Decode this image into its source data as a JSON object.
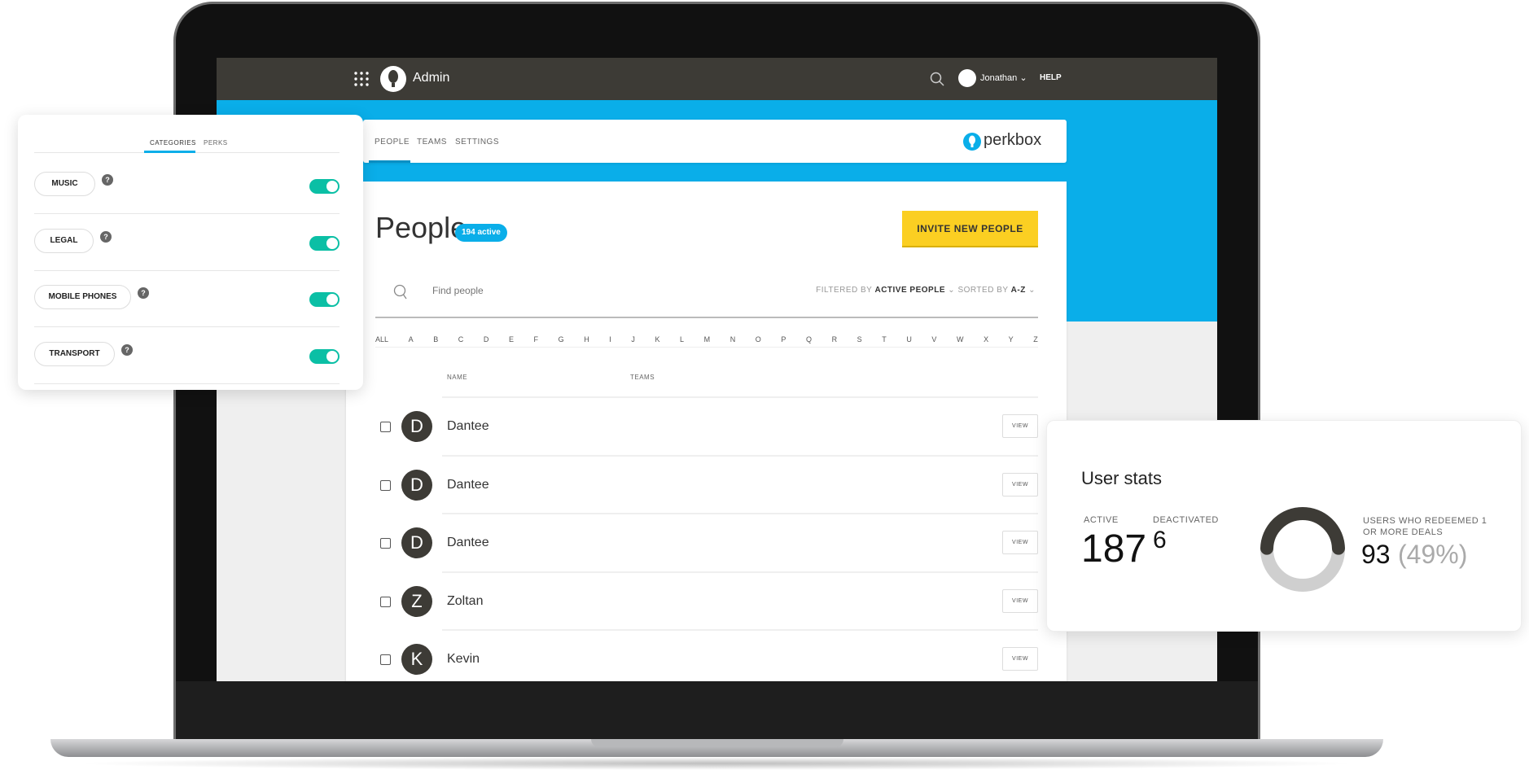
{
  "topbar": {
    "app_title": "Admin",
    "user_name": "Jonathan",
    "help_label": "HELP"
  },
  "nav_tabs": [
    {
      "label": "PEOPLE",
      "active": true
    },
    {
      "label": "TEAMS"
    },
    {
      "label": "SETTINGS"
    }
  ],
  "brand": {
    "name": "perkbox",
    "color": "#0aaee9"
  },
  "people": {
    "title": "People",
    "badge": "194 active",
    "invite_button": "INVITE NEW PEOPLE",
    "invite_color": "#fbcf22",
    "search_placeholder": "Find people",
    "filter_prefix": "FILTERED BY",
    "filter_value": "ACTIVE PEOPLE",
    "sort_prefix": "SORTED BY",
    "sort_value": "A-Z",
    "alphabet": [
      "ALL",
      "A",
      "B",
      "C",
      "D",
      "E",
      "F",
      "G",
      "H",
      "I",
      "J",
      "K",
      "L",
      "M",
      "N",
      "O",
      "P",
      "Q",
      "R",
      "S",
      "T",
      "U",
      "V",
      "W",
      "X",
      "Y",
      "Z"
    ],
    "columns": {
      "name": "NAME",
      "teams": "TEAMS"
    },
    "rows": [
      {
        "initial": "D",
        "name": "Dantee",
        "action": "VIEW"
      },
      {
        "initial": "D",
        "name": "Dantee",
        "action": "VIEW"
      },
      {
        "initial": "D",
        "name": "Dantee",
        "action": "VIEW"
      },
      {
        "initial": "Z",
        "name": "Zoltan",
        "action": "VIEW"
      },
      {
        "initial": "K",
        "name": "Kevin",
        "action": "VIEW"
      }
    ]
  },
  "categories_panel": {
    "tabs": [
      {
        "label": "CATEGORIES",
        "active": true
      },
      {
        "label": "PERKS"
      }
    ],
    "items": [
      {
        "label": "MUSIC",
        "enabled": true
      },
      {
        "label": "LEGAL",
        "enabled": true
      },
      {
        "label": "MOBILE PHONES",
        "enabled": true
      },
      {
        "label": "TRANSPORT",
        "enabled": true
      }
    ],
    "toggle_color": "#0bbfa5"
  },
  "user_stats": {
    "title": "User stats",
    "active_label": "ACTIVE",
    "active_value": "187",
    "deactivated_label": "DEACTIVATED",
    "deactivated_value": "6",
    "redeemed_label": "USERS WHO REDEEMED 1 OR MORE DEALS",
    "redeemed_value": "93",
    "redeemed_percent_text": "(49%)",
    "redeemed_fraction": 0.49
  }
}
